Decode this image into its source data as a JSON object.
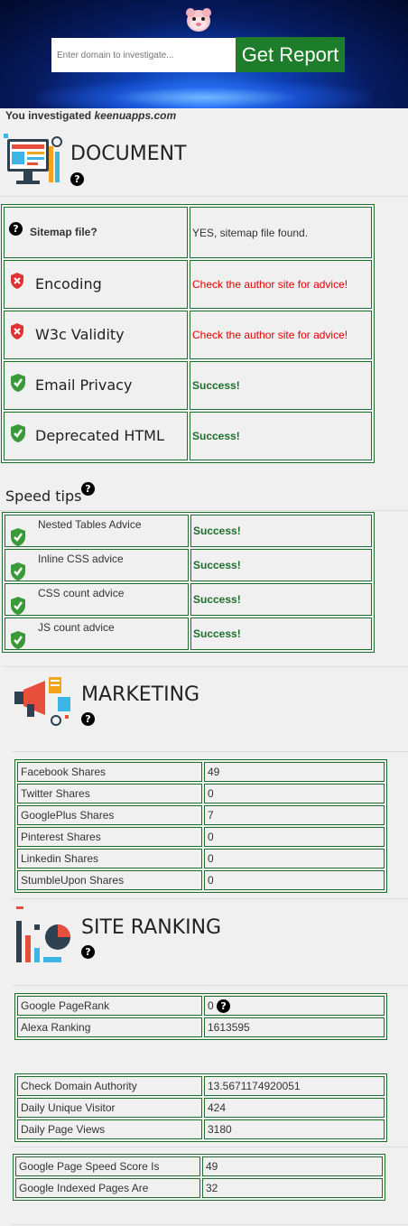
{
  "header": {
    "search_placeholder": "Enter domain to investigate...",
    "get_report_label": "Get Report"
  },
  "investigated": {
    "prefix": "You investigated",
    "domain": "keenuapps.com"
  },
  "document": {
    "title": "DOCUMENT",
    "rows": [
      {
        "label": "Sitemap file?",
        "result": "YES, sitemap file found.",
        "status": "info",
        "icon": "question-icon"
      },
      {
        "label": "Encoding",
        "result": "Check the author site for advice!",
        "status": "fail",
        "icon": "shield-fail-icon"
      },
      {
        "label": "W3c Validity",
        "result": "Check the author site for advice!",
        "status": "fail",
        "icon": "shield-fail-icon"
      },
      {
        "label": "Email Privacy",
        "result": "Success!",
        "status": "pass",
        "icon": "shield-check-icon"
      },
      {
        "label": "Deprecated HTML",
        "result": "Success!",
        "status": "pass",
        "icon": "shield-check-icon"
      }
    ]
  },
  "speed_tips": {
    "title": "Speed tips",
    "rows": [
      {
        "label": "Nested Tables Advice",
        "result": "Success!"
      },
      {
        "label": "Inline CSS advice",
        "result": "Success!"
      },
      {
        "label": "CSS count advice",
        "result": "Success!"
      },
      {
        "label": "JS count advice",
        "result": "Success!"
      }
    ]
  },
  "marketing": {
    "title": "MARKETING",
    "rows": [
      {
        "label": "Facebook Shares",
        "value": "49"
      },
      {
        "label": "Twitter Shares",
        "value": "0"
      },
      {
        "label": "GooglePlus Shares",
        "value": "7"
      },
      {
        "label": "Pinterest Shares",
        "value": "0"
      },
      {
        "label": "Linkedin Shares",
        "value": "0"
      },
      {
        "label": "StumbleUpon Shares",
        "value": "0"
      }
    ]
  },
  "site_ranking": {
    "title": "SITE RANKING",
    "table1": [
      {
        "label": "Google PageRank",
        "value": "0"
      },
      {
        "label": "Alexa Ranking",
        "value": "1613595"
      }
    ],
    "table2": [
      {
        "label": "Check Domain Authority",
        "value": "13.5671174920051"
      },
      {
        "label": "Daily Unique Visitor",
        "value": "424"
      },
      {
        "label": "Daily Page Views",
        "value": "3180"
      }
    ],
    "table3": [
      {
        "label": "Google Page Speed Score Is",
        "value": "49"
      },
      {
        "label": "Google Indexed Pages Are",
        "value": "32"
      }
    ]
  },
  "colors": {
    "success": "#1e6e2b",
    "fail": "#e60000",
    "button": "#1e7d2b",
    "border": "#1e6e2b"
  }
}
